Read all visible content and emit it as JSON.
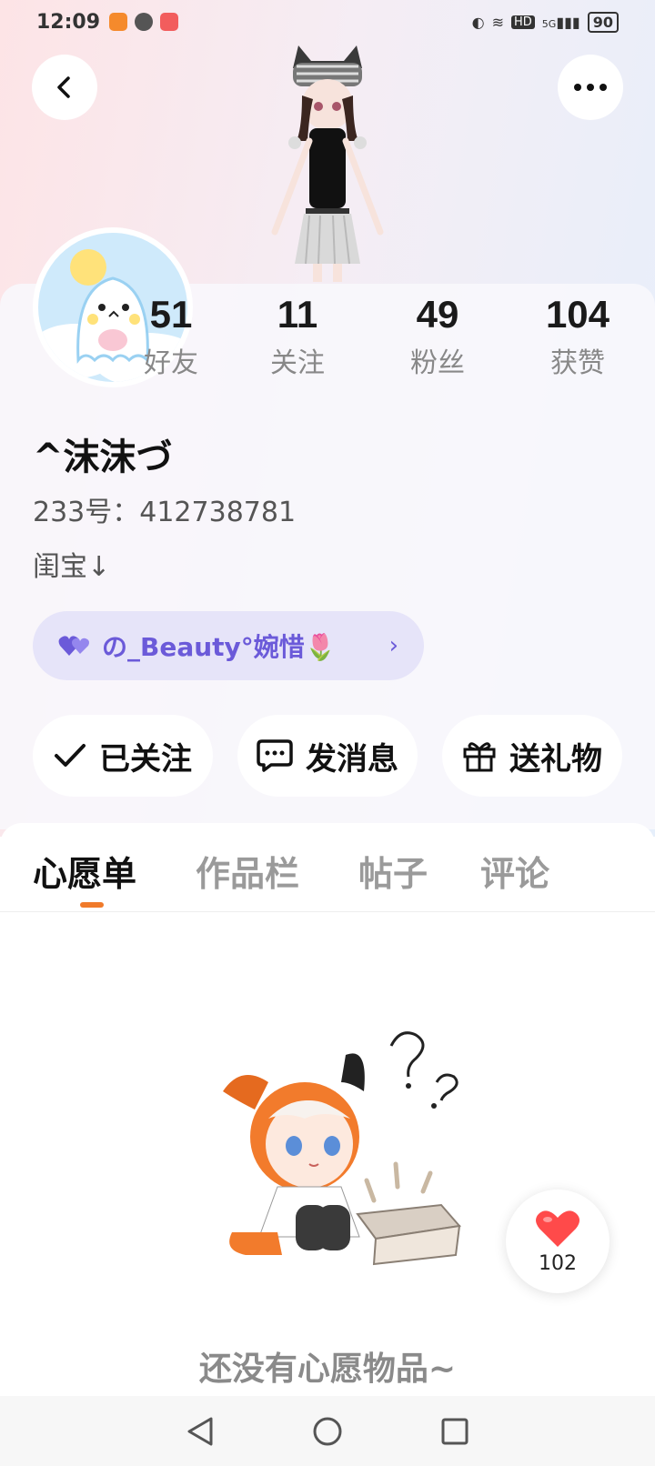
{
  "status_bar": {
    "time": "12:09",
    "battery": "90",
    "hd": "HD",
    "net": "5G"
  },
  "profile": {
    "username": "^沫沫づ",
    "uid": "233号：412738781",
    "bio": "闺宝↓",
    "partner_tag": "の_Beauty°婉惜🌷"
  },
  "stats": [
    {
      "value": "51",
      "label": "好友"
    },
    {
      "value": "11",
      "label": "关注"
    },
    {
      "value": "49",
      "label": "粉丝"
    },
    {
      "value": "104",
      "label": "获赞"
    }
  ],
  "actions": {
    "follow": "已关注",
    "message": "发消息",
    "gift": "送礼物"
  },
  "tabs": [
    "心愿单",
    "作品栏",
    "帖子",
    "评论"
  ],
  "empty_text": "还没有心愿物品~",
  "like_count": "102",
  "colors": {
    "accent": "#f07a2a",
    "partner": "#6b5ad9",
    "like": "#ff4a4a"
  }
}
